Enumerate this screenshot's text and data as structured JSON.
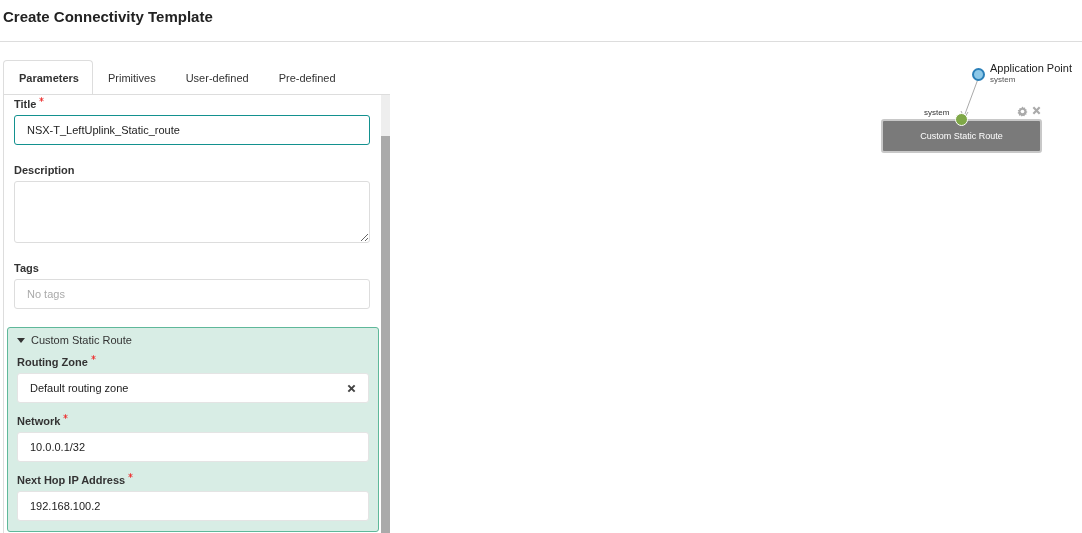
{
  "title": "Create Connectivity Template",
  "tabs": [
    {
      "label": "Parameters",
      "selected": true
    },
    {
      "label": "Primitives",
      "selected": false
    },
    {
      "label": "User-defined",
      "selected": false
    },
    {
      "label": "Pre-defined",
      "selected": false
    }
  ],
  "fields": [
    {
      "kind": "input",
      "label": "Title",
      "required": true,
      "focused": true,
      "value": "NSX-T_LeftUplink_Static_route"
    },
    {
      "kind": "textarea",
      "label": "Description",
      "required": false,
      "focused": false
    },
    {
      "kind": "input",
      "label": "Tags",
      "required": false,
      "focused": false,
      "placeholder": "No tags"
    }
  ],
  "primitive": {
    "title": "Custom Static Route",
    "expanded": true,
    "fields": [
      {
        "kind": "select",
        "label": "Routing Zone",
        "required": true,
        "value": "Default routing zone"
      },
      {
        "kind": "input",
        "label": "Network",
        "required": true,
        "value": "10.0.0.1/32"
      },
      {
        "kind": "input",
        "label": "Next Hop IP Address",
        "required": true,
        "value": "192.168.100.2"
      }
    ]
  },
  "canvas": {
    "application_point": {
      "label": "Application Point",
      "sublabel": "system"
    },
    "node": {
      "port_label": "system",
      "title": "Custom Static Route"
    }
  }
}
